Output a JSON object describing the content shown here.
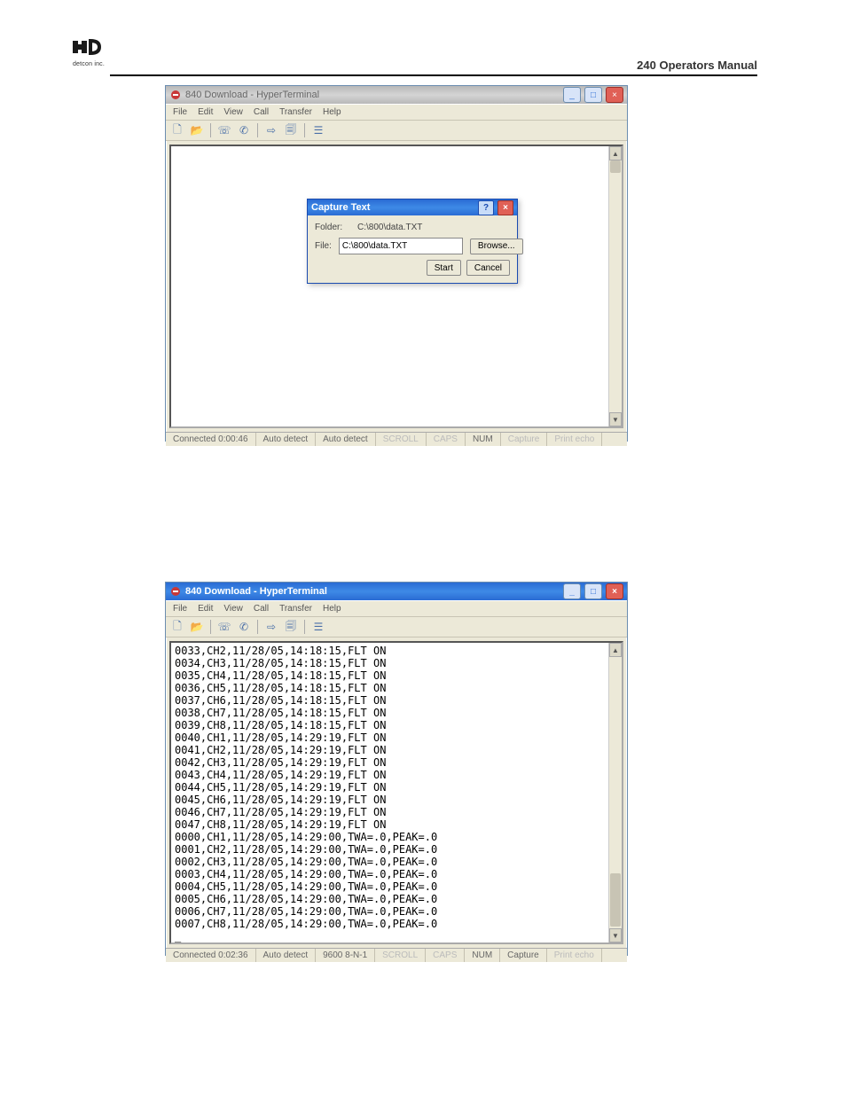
{
  "logo_text": "detcon inc.",
  "manual_title": "240 Operators Manual",
  "win1": {
    "title": "840 Download - HyperTerminal",
    "menu": [
      "File",
      "Edit",
      "View",
      "Call",
      "Transfer",
      "Help"
    ],
    "status": {
      "conn": "Connected 0:00:46",
      "autodetect1": "Auto detect",
      "autodetect2": "Auto detect",
      "scroll": "SCROLL",
      "caps": "CAPS",
      "num": "NUM",
      "capture": "Capture",
      "printecho": "Print echo"
    }
  },
  "dialog": {
    "title": "Capture Text",
    "labels": {
      "folder": "Folder:",
      "file": "File:"
    },
    "folder_value": "C:\\800\\data.TXT",
    "file_value": "C:\\800\\data.TXT",
    "browse": "Browse...",
    "start": "Start",
    "cancel": "Cancel"
  },
  "win2": {
    "title": "840 Download - HyperTerminal",
    "menu": [
      "File",
      "Edit",
      "View",
      "Call",
      "Transfer",
      "Help"
    ],
    "lines": [
      "0033,CH2,11/28/05,14:18:15,FLT ON",
      "0034,CH3,11/28/05,14:18:15,FLT ON",
      "0035,CH4,11/28/05,14:18:15,FLT ON",
      "0036,CH5,11/28/05,14:18:15,FLT ON",
      "0037,CH6,11/28/05,14:18:15,FLT ON",
      "0038,CH7,11/28/05,14:18:15,FLT ON",
      "0039,CH8,11/28/05,14:18:15,FLT ON",
      "0040,CH1,11/28/05,14:29:19,FLT ON",
      "0041,CH2,11/28/05,14:29:19,FLT ON",
      "0042,CH3,11/28/05,14:29:19,FLT ON",
      "0043,CH4,11/28/05,14:29:19,FLT ON",
      "0044,CH5,11/28/05,14:29:19,FLT ON",
      "0045,CH6,11/28/05,14:29:19,FLT ON",
      "0046,CH7,11/28/05,14:29:19,FLT ON",
      "0047,CH8,11/28/05,14:29:19,FLT ON",
      "0000,CH1,11/28/05,14:29:00,TWA=.0,PEAK=.0",
      "0001,CH2,11/28/05,14:29:00,TWA=.0,PEAK=.0",
      "0002,CH3,11/28/05,14:29:00,TWA=.0,PEAK=.0",
      "0003,CH4,11/28/05,14:29:00,TWA=.0,PEAK=.0",
      "0004,CH5,11/28/05,14:29:00,TWA=.0,PEAK=.0",
      "0005,CH6,11/28/05,14:29:00,TWA=.0,PEAK=.0",
      "0006,CH7,11/28/05,14:29:00,TWA=.0,PEAK=.0",
      "0007,CH8,11/28/05,14:29:00,TWA=.0,PEAK=.0",
      "_"
    ],
    "status": {
      "conn": "Connected 0:02:36",
      "autodetect": "Auto detect",
      "baud": "9600 8-N-1",
      "scroll": "SCROLL",
      "caps": "CAPS",
      "num": "NUM",
      "capture": "Capture",
      "printecho": "Print echo"
    }
  }
}
